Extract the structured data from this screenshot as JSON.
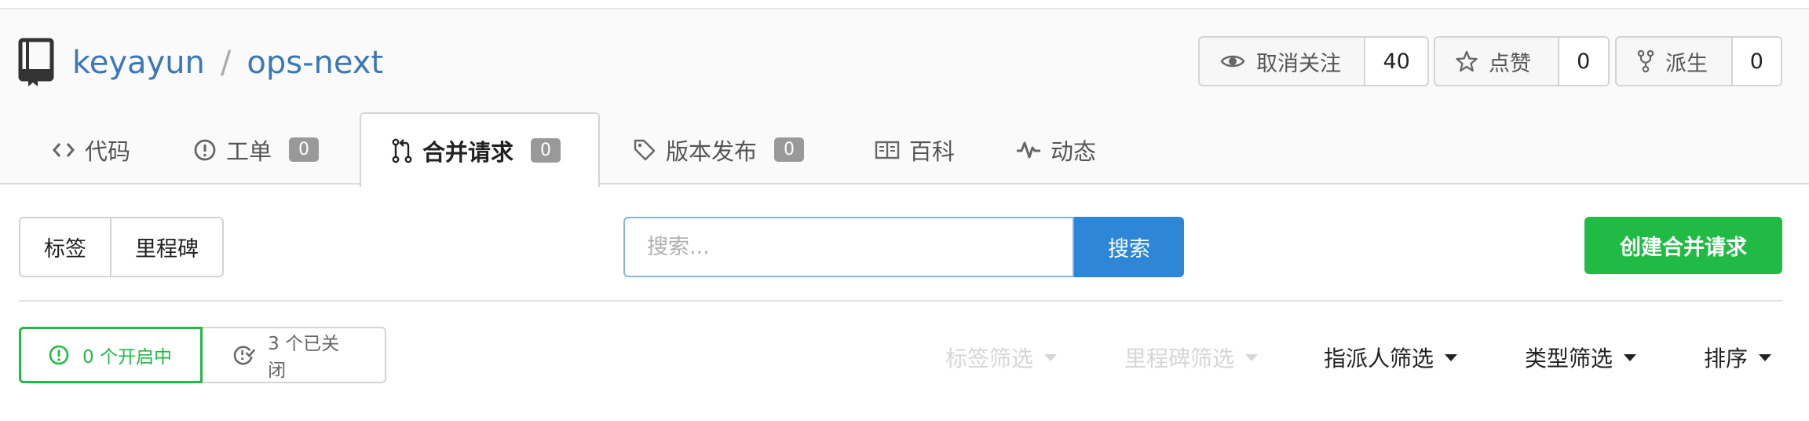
{
  "repo": {
    "owner": "keyayun",
    "separator": "/",
    "name": "ops-next"
  },
  "actions": {
    "watch": {
      "label": "取消关注",
      "count": "40"
    },
    "star": {
      "label": "点赞",
      "count": "0"
    },
    "fork": {
      "label": "派生",
      "count": "0"
    }
  },
  "tabs": [
    {
      "label": "代码",
      "icon": "code-icon"
    },
    {
      "label": "工单",
      "icon": "issue-icon",
      "badge": "0"
    },
    {
      "label": "合并请求",
      "icon": "pull-request-icon",
      "badge": "0",
      "active": true
    },
    {
      "label": "版本发布",
      "icon": "tag-icon",
      "badge": "0"
    },
    {
      "label": "百科",
      "icon": "book-icon"
    },
    {
      "label": "动态",
      "icon": "pulse-icon"
    }
  ],
  "filters": {
    "labels": "标签",
    "milestones": "里程碑"
  },
  "search": {
    "placeholder": "搜索...",
    "button": "搜索"
  },
  "create_button": "创建合并请求",
  "state": {
    "open": "0 个开启中",
    "closed": "3 个已关闭"
  },
  "dropdowns": {
    "label_filter": "标签筛选",
    "milestone_filter": "里程碑筛选",
    "assignee_filter": "指派人筛选",
    "type_filter": "类型筛选",
    "sort": "排序"
  },
  "colors": {
    "link": "#3a78b9",
    "primary": "#2d86d6",
    "success": "#21ba45",
    "badge": "#999999"
  }
}
